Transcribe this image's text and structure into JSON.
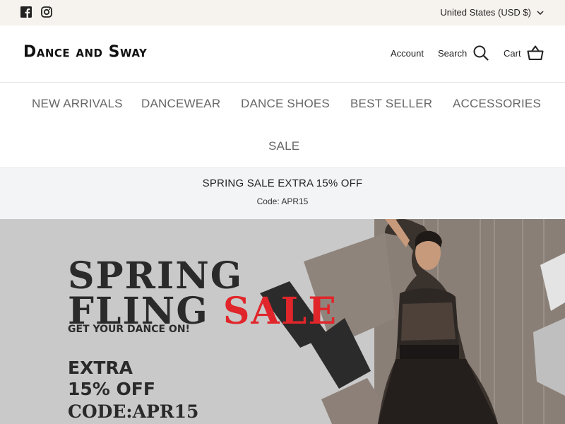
{
  "topbar": {
    "social": [
      "facebook-icon",
      "instagram-icon"
    ],
    "currency": "United States (USD $)"
  },
  "header": {
    "logo": "Dance and Sway",
    "account": "Account",
    "search": "Search",
    "cart": "Cart"
  },
  "nav": {
    "items": [
      "NEW ARRIVALS",
      "DANCEWEAR",
      "DANCE SHOES",
      "BEST SELLER",
      "ACCESSORIES",
      "SALE"
    ]
  },
  "announcement": {
    "title": "SPRING SALE EXTRA 15% OFF",
    "code": "Code: APR15"
  },
  "hero": {
    "line1": "SPRING",
    "line2_a": "FLING ",
    "line2_b": "SALE",
    "subtitle": "GET YOUR DANCE ON!",
    "extra": "EXTRA",
    "off": "15% OFF",
    "code": "CODE:APR15"
  },
  "colors": {
    "topbar_bg": "#f6f2ee",
    "announce_bg": "#f3f4f6",
    "hero_bg": "#c8c8c8",
    "sale_red": "#e0262b"
  }
}
